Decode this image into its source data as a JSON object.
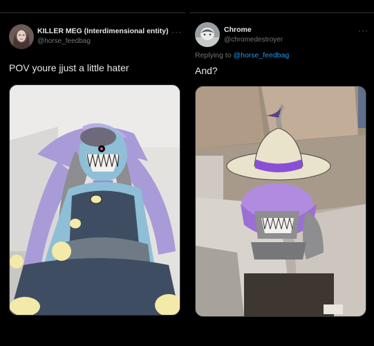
{
  "left_tweet": {
    "display_name": "KILLER MEG (Interdimensional entity)",
    "handle": "@horse_feedbag",
    "more_glyph": "···",
    "text": "POV youre jjust a little hater"
  },
  "right_tweet": {
    "display_name": "Chrome",
    "handle": "@chromedestroyer",
    "more_glyph": "···",
    "reply_prefix": "Replying to",
    "reply_to": "@horse_feedbag",
    "text": "And?"
  },
  "icons": {
    "left_avatar": "profile-photo",
    "right_avatar": "chrome-profile-photo",
    "more": "more-dots-icon"
  },
  "colors": {
    "background": "#000000",
    "text_primary": "#e7e9ea",
    "text_secondary": "#71767b",
    "mention": "#1d9bf0"
  }
}
